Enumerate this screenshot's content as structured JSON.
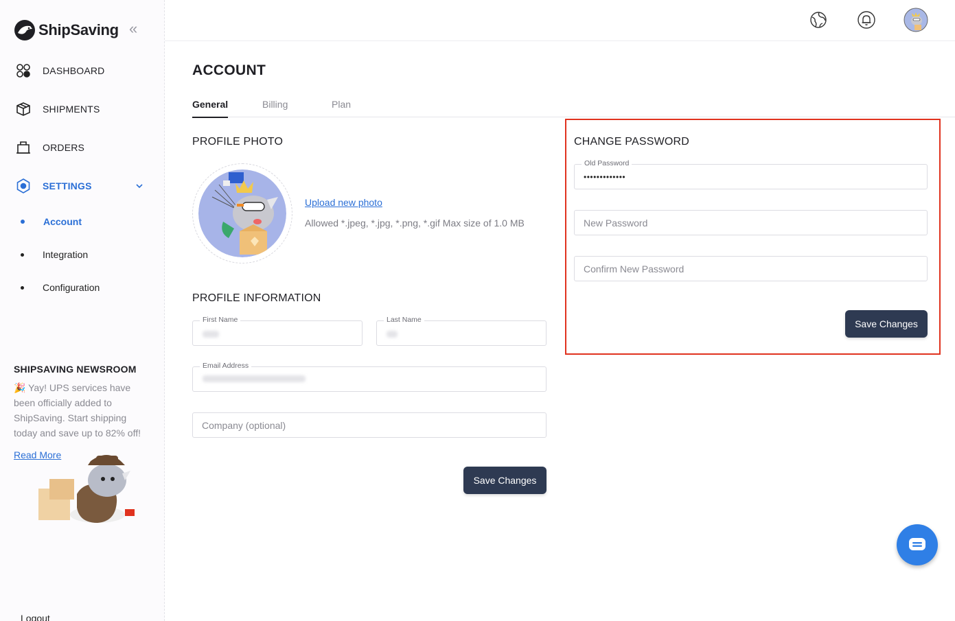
{
  "brand": {
    "name": "ShipSaving"
  },
  "sidebar": {
    "items": [
      {
        "label": "DASHBOARD"
      },
      {
        "label": "SHIPMENTS"
      },
      {
        "label": "ORDERS"
      },
      {
        "label": "SETTINGS"
      }
    ],
    "subitems": [
      {
        "label": "Account"
      },
      {
        "label": "Integration"
      },
      {
        "label": "Configuration"
      }
    ],
    "newsroom": {
      "title": "SHIPSAVING NEWSROOM",
      "text": "🎉 Yay! UPS services have been officially added to ShipSaving. Start shipping today and save up to 82% off!",
      "read_more": "Read More"
    },
    "logout": "Logout"
  },
  "page": {
    "title": "ACCOUNT",
    "tabs": [
      {
        "label": "General"
      },
      {
        "label": "Billing"
      },
      {
        "label": "Plan"
      }
    ]
  },
  "profile_photo": {
    "title": "PROFILE PHOTO",
    "upload_label": "Upload new photo",
    "hint": "Allowed *.jpeg, *.jpg, *.png, *.gif Max size of 1.0 MB"
  },
  "profile_info": {
    "title": "PROFILE INFORMATION",
    "first_name_label": "First Name",
    "last_name_label": "Last Name",
    "email_label": "Email Address",
    "company_placeholder": "Company (optional)",
    "save_label": "Save Changes"
  },
  "change_password": {
    "title": "CHANGE PASSWORD",
    "old_label": "Old Password",
    "old_value": "•••••••••••••",
    "new_placeholder": "New Password",
    "confirm_placeholder": "Confirm New Password",
    "save_label": "Save Changes"
  },
  "colors": {
    "accent": "#2b6fd6",
    "button": "#2e3a52",
    "highlight_border": "#e0321e",
    "chat": "#2f7fe6"
  },
  "icons": [
    "logo-icon",
    "collapse-icon",
    "dashboard-icon",
    "shipments-icon",
    "orders-icon",
    "settings-icon",
    "chevron-down-icon",
    "globe-icon",
    "bell-icon",
    "user-avatar",
    "chat-icon"
  ]
}
